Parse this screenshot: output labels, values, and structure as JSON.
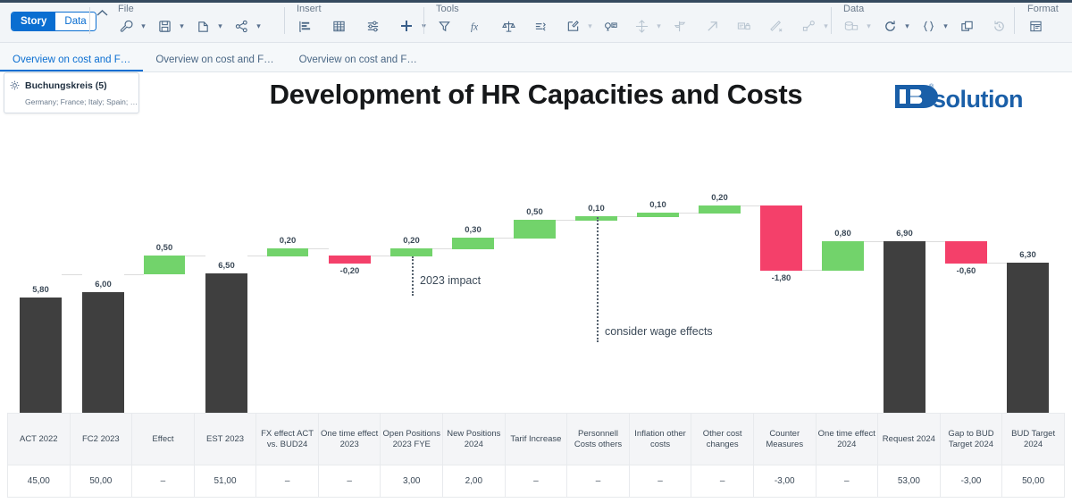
{
  "toolbar": {
    "mode_story": "Story",
    "mode_data": "Data",
    "groups": [
      {
        "label": "File",
        "icons": [
          "wrench-icon",
          "save-icon",
          "copy-icon",
          "share-icon"
        ]
      },
      {
        "label": "Insert",
        "icons": [
          "chart-icon",
          "table-icon",
          "filter-controls-icon",
          "plus-icon"
        ]
      },
      {
        "label": "Tools",
        "icons": [
          "funnel-icon",
          "formula-icon",
          "balance-icon",
          "sort-icon",
          "edit-icon",
          "smart-insight-icon",
          "drill-icon",
          "signpost-icon",
          "arrow-up-right-icon",
          "card-lock-icon",
          "pen-strike-icon",
          "node-link-icon"
        ]
      },
      {
        "label": "Data",
        "icons": [
          "database-icon",
          "refresh-icon",
          "braces-icon",
          "layers-icon",
          "history-icon"
        ]
      },
      {
        "label": "Format",
        "icons": [
          "format-panel-icon"
        ]
      }
    ]
  },
  "tabs": [
    {
      "label": "Overview on cost and F…",
      "active": true
    },
    {
      "label": "Overview on cost and F…",
      "active": false
    },
    {
      "label": "Overview on cost and F…",
      "active": false
    }
  ],
  "filter_chip": {
    "icon": "filter-settings-icon",
    "title": "Buchungskreis (5)",
    "subtitle": "Germany; France; Italy; Spain; …"
  },
  "header": {
    "chart_title": "Development of HR Capacities and Costs",
    "logo_text": "solution",
    "logo_mark": "IB",
    "logo_reg": "®",
    "logo_color": "#1a5fa8"
  },
  "colors": {
    "neutral_bar": "#3f3f3f",
    "increase_bar": "#72d36b",
    "decrease_bar": "#f4406a",
    "accent": "#0a6ed1"
  },
  "annotations": [
    {
      "text": "2023 impact",
      "underlined": true
    },
    {
      "text": "consider wage effects",
      "underlined": false
    }
  ],
  "chart_data": {
    "type": "bar",
    "subtype": "waterfall",
    "title": "Development of HR Capacities and Costs",
    "xlabel": "",
    "ylabel": "",
    "grid": false,
    "legend": "none",
    "categories": [
      "ACT 2022",
      "FC2 2023",
      "Effect",
      "EST 2023",
      "FX effect ACT vs. BUD24",
      "One time effect 2023",
      "Open Positions 2023 FYE",
      "New Positions 2024",
      "Tarif Increase",
      "Personnell Costs others",
      "Inflation other costs",
      "Other cost changes",
      "Counter Measures",
      "One time effect 2024",
      "Request 2024",
      "Gap to BUD Target 2024",
      "BUD Target 2024"
    ],
    "bar_labels": [
      "5,80",
      "6,00",
      "0,50",
      "6,50",
      "0,20",
      "-0,20",
      "0,20",
      "0,30",
      "0,50",
      "0,10",
      "0,10",
      "0,20",
      "-1,80",
      "0,80",
      "6,90",
      "-0,60",
      "6,30"
    ],
    "values": [
      5.8,
      6.0,
      0.5,
      6.5,
      0.2,
      -0.2,
      0.2,
      0.3,
      0.5,
      0.1,
      0.1,
      0.2,
      -1.8,
      0.8,
      6.9,
      -0.6,
      6.3
    ],
    "bar_kinds": [
      "total",
      "total",
      "increase",
      "total",
      "increase",
      "decrease",
      "increase",
      "increase",
      "increase",
      "increase",
      "increase",
      "increase",
      "decrease",
      "increase",
      "total",
      "decrease",
      "total"
    ],
    "cumulative_start": [
      0,
      0,
      6.0,
      0,
      6.5,
      6.5,
      6.5,
      6.7,
      7.0,
      7.5,
      7.6,
      7.7,
      7.9,
      6.1,
      0,
      6.9,
      0
    ],
    "ylim": [
      0,
      8.2
    ]
  },
  "table": {
    "headers": [
      "ACT 2022",
      "FC2 2023",
      "Effect",
      "EST 2023",
      "FX effect ACT vs. BUD24",
      "One time effect 2023",
      "Open Positions 2023 FYE",
      "New Positions 2024",
      "Tarif Increase",
      "Personnell Costs others",
      "Inflation other costs",
      "Other cost changes",
      "Counter Measures",
      "One time effect 2024",
      "Request 2024",
      "Gap to BUD Target 2024",
      "BUD Target 2024"
    ],
    "rows": [
      [
        "45,00",
        "50,00",
        "–",
        "51,00",
        "–",
        "–",
        "3,00",
        "2,00",
        "–",
        "–",
        "–",
        "–",
        "-3,00",
        "–",
        "53,00",
        "-3,00",
        "50,00"
      ]
    ]
  }
}
